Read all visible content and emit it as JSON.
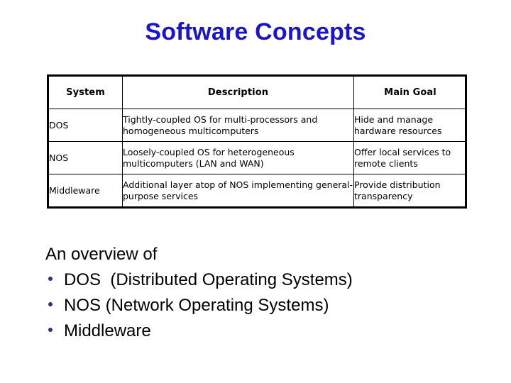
{
  "slide": {
    "title": "Software Concepts",
    "title_color": "#1a14cf",
    "background_color": "#ffffff"
  },
  "table": {
    "headers": [
      "System",
      "Description",
      "Main Goal"
    ],
    "rows": [
      {
        "system": "DOS",
        "description": "Tightly-coupled OS for multi-processors and homogeneous multicomputers",
        "main_goal": "Hide and manage hardware resources"
      },
      {
        "system": "NOS",
        "description": "Loosely-coupled OS for heterogeneous multicomputers (LAN and WAN)",
        "main_goal": "Offer local services to remote clients"
      },
      {
        "system": "Middleware",
        "description": "Additional layer atop of NOS implementing general-purpose services",
        "main_goal": "Provide distribution transparency"
      }
    ]
  },
  "overview": {
    "lead": "An overview of",
    "bullet_color": "#32307e",
    "items": [
      "DOS  (Distributed Operating Systems)",
      "NOS (Network Operating Systems)",
      "Middleware"
    ]
  }
}
